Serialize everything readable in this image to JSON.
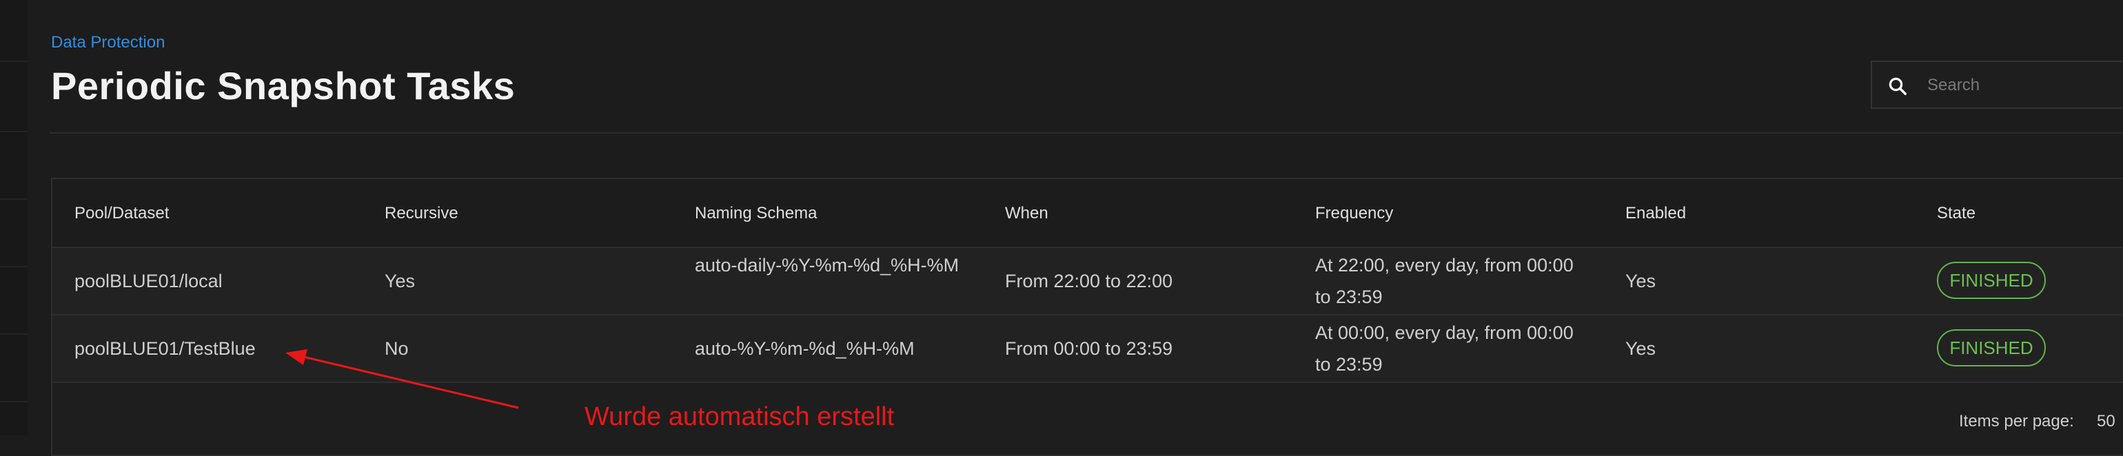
{
  "breadcrumb": "Data Protection",
  "page_title": "Periodic Snapshot Tasks",
  "search": {
    "placeholder": "Search",
    "value": ""
  },
  "table": {
    "columns": [
      "Pool/Dataset",
      "Recursive",
      "Naming Schema",
      "When",
      "Frequency",
      "Enabled",
      "State"
    ],
    "rows": [
      {
        "dataset": "poolBLUE01/local",
        "recursive": "Yes",
        "naming_schema": "auto-daily-%Y-%m-%d_%H-%M",
        "when": "From 22:00 to 22:00",
        "frequency": "At 22:00, every day, from 00:00 to 23:59",
        "enabled": "Yes",
        "state": "FINISHED"
      },
      {
        "dataset": "poolBLUE01/TestBlue",
        "recursive": "No",
        "naming_schema": "auto-%Y-%m-%d_%H-%M",
        "when": "From 00:00 to 23:59",
        "frequency": "At 00:00, every day, from 00:00 to 23:59",
        "enabled": "Yes",
        "state": "FINISHED"
      }
    ]
  },
  "pagination": {
    "label": "Items per page:",
    "value": "50"
  },
  "annotation": {
    "text": "Wurde automatisch erstellt"
  },
  "colors": {
    "accent": "#2f8fde",
    "status_ok": "#6cc04f",
    "annotation": "#e81818",
    "background": "#1c1c1c"
  },
  "icons": {
    "search": "search-icon",
    "arrow": "arrow-annotation"
  }
}
